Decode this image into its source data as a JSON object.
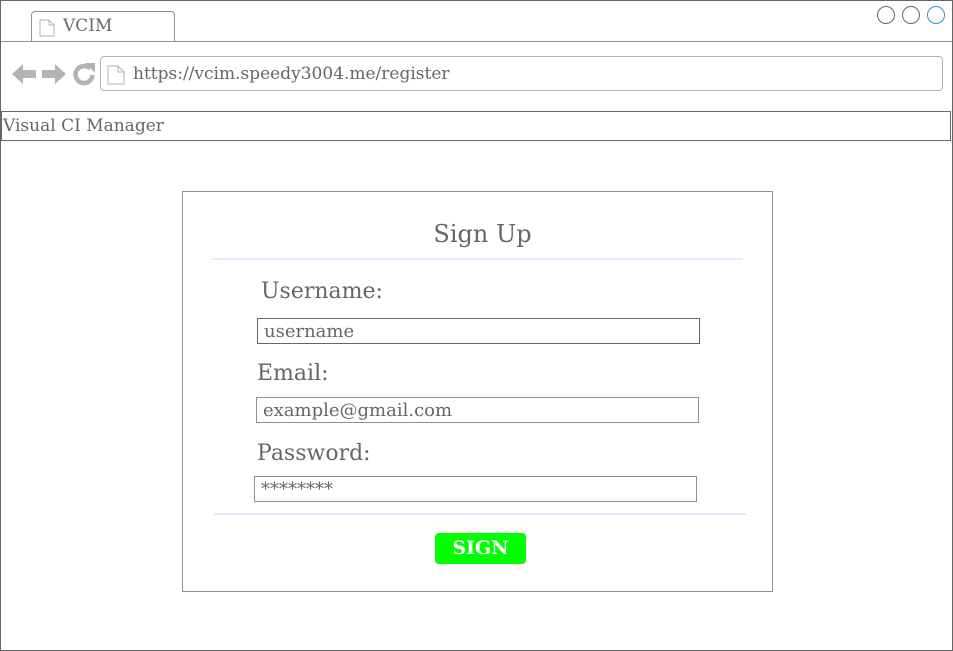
{
  "browser": {
    "tab_title": "VCIM",
    "url": "https://vcim.speedy3004.me/register",
    "icons": {
      "back": "back-arrow-icon",
      "forward": "forward-arrow-icon",
      "reload": "reload-icon",
      "page": "page-icon"
    }
  },
  "app": {
    "title": "Visual CI Manager"
  },
  "form": {
    "title": "Sign Up",
    "username": {
      "label": "Username:",
      "value": "username"
    },
    "email": {
      "label": "Email:",
      "value": "example@gmail.com"
    },
    "password": {
      "label": "Password:",
      "value": "********"
    },
    "submit_label": "SIGN UP"
  },
  "colors": {
    "text": "#666666",
    "border": "#666666",
    "divider": "#e1ebff",
    "button": "#00ff00",
    "button_text": "#ffffff",
    "window_button_accent": "#2a93d6"
  }
}
